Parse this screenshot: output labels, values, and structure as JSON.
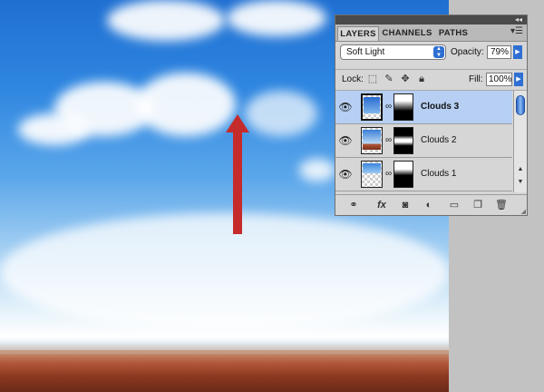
{
  "panel": {
    "tabs": [
      {
        "label": "LAYERS",
        "active": true
      },
      {
        "label": "CHANNELS",
        "active": false
      },
      {
        "label": "PATHS",
        "active": false
      }
    ],
    "blend_mode": "Soft Light",
    "opacity_label": "Opacity:",
    "opacity_value": "79%",
    "lock_label": "Lock:",
    "fill_label": "Fill:",
    "fill_value": "100%",
    "layers": [
      {
        "name": "Clouds 3",
        "selected": true,
        "visible": true
      },
      {
        "name": "Clouds 2",
        "selected": false,
        "visible": true
      },
      {
        "name": "Clouds 1",
        "selected": false,
        "visible": true
      }
    ],
    "footer_icons": [
      "link-layers-icon",
      "fx-icon",
      "add-mask-icon",
      "adjustment-layer-icon",
      "new-group-icon",
      "new-layer-icon",
      "delete-layer-icon"
    ]
  },
  "colors": {
    "arrow": "#c62b2b",
    "selected_layer": "#b6cff3",
    "accent_blue": "#2f6fd3"
  }
}
